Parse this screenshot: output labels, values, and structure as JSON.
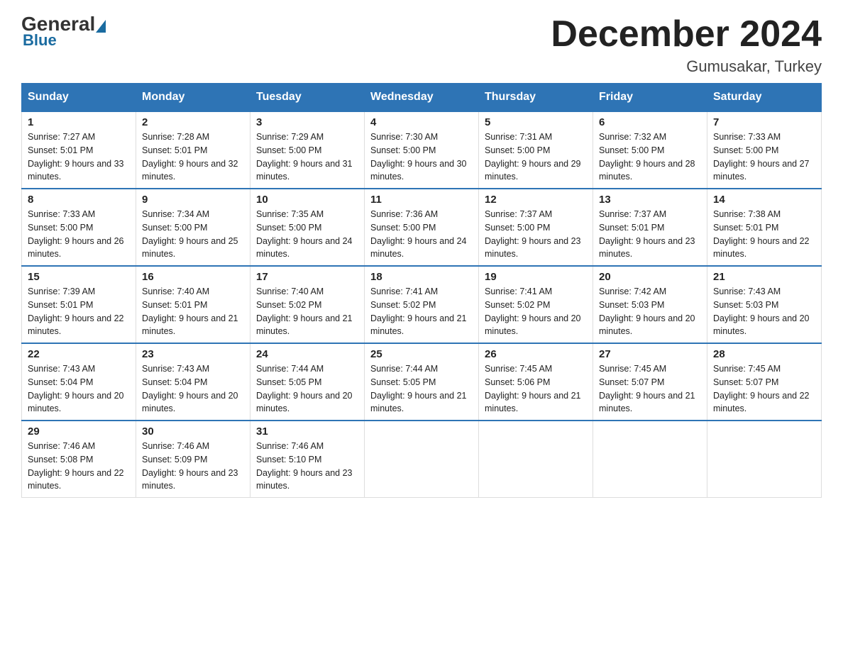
{
  "logo": {
    "general": "General",
    "blue": "Blue"
  },
  "header": {
    "month": "December 2024",
    "location": "Gumusakar, Turkey"
  },
  "days_of_week": [
    "Sunday",
    "Monday",
    "Tuesday",
    "Wednesday",
    "Thursday",
    "Friday",
    "Saturday"
  ],
  "weeks": [
    [
      {
        "day": "1",
        "sunrise": "7:27 AM",
        "sunset": "5:01 PM",
        "daylight": "9 hours and 33 minutes."
      },
      {
        "day": "2",
        "sunrise": "7:28 AM",
        "sunset": "5:01 PM",
        "daylight": "9 hours and 32 minutes."
      },
      {
        "day": "3",
        "sunrise": "7:29 AM",
        "sunset": "5:00 PM",
        "daylight": "9 hours and 31 minutes."
      },
      {
        "day": "4",
        "sunrise": "7:30 AM",
        "sunset": "5:00 PM",
        "daylight": "9 hours and 30 minutes."
      },
      {
        "day": "5",
        "sunrise": "7:31 AM",
        "sunset": "5:00 PM",
        "daylight": "9 hours and 29 minutes."
      },
      {
        "day": "6",
        "sunrise": "7:32 AM",
        "sunset": "5:00 PM",
        "daylight": "9 hours and 28 minutes."
      },
      {
        "day": "7",
        "sunrise": "7:33 AM",
        "sunset": "5:00 PM",
        "daylight": "9 hours and 27 minutes."
      }
    ],
    [
      {
        "day": "8",
        "sunrise": "7:33 AM",
        "sunset": "5:00 PM",
        "daylight": "9 hours and 26 minutes."
      },
      {
        "day": "9",
        "sunrise": "7:34 AM",
        "sunset": "5:00 PM",
        "daylight": "9 hours and 25 minutes."
      },
      {
        "day": "10",
        "sunrise": "7:35 AM",
        "sunset": "5:00 PM",
        "daylight": "9 hours and 24 minutes."
      },
      {
        "day": "11",
        "sunrise": "7:36 AM",
        "sunset": "5:00 PM",
        "daylight": "9 hours and 24 minutes."
      },
      {
        "day": "12",
        "sunrise": "7:37 AM",
        "sunset": "5:00 PM",
        "daylight": "9 hours and 23 minutes."
      },
      {
        "day": "13",
        "sunrise": "7:37 AM",
        "sunset": "5:01 PM",
        "daylight": "9 hours and 23 minutes."
      },
      {
        "day": "14",
        "sunrise": "7:38 AM",
        "sunset": "5:01 PM",
        "daylight": "9 hours and 22 minutes."
      }
    ],
    [
      {
        "day": "15",
        "sunrise": "7:39 AM",
        "sunset": "5:01 PM",
        "daylight": "9 hours and 22 minutes."
      },
      {
        "day": "16",
        "sunrise": "7:40 AM",
        "sunset": "5:01 PM",
        "daylight": "9 hours and 21 minutes."
      },
      {
        "day": "17",
        "sunrise": "7:40 AM",
        "sunset": "5:02 PM",
        "daylight": "9 hours and 21 minutes."
      },
      {
        "day": "18",
        "sunrise": "7:41 AM",
        "sunset": "5:02 PM",
        "daylight": "9 hours and 21 minutes."
      },
      {
        "day": "19",
        "sunrise": "7:41 AM",
        "sunset": "5:02 PM",
        "daylight": "9 hours and 20 minutes."
      },
      {
        "day": "20",
        "sunrise": "7:42 AM",
        "sunset": "5:03 PM",
        "daylight": "9 hours and 20 minutes."
      },
      {
        "day": "21",
        "sunrise": "7:43 AM",
        "sunset": "5:03 PM",
        "daylight": "9 hours and 20 minutes."
      }
    ],
    [
      {
        "day": "22",
        "sunrise": "7:43 AM",
        "sunset": "5:04 PM",
        "daylight": "9 hours and 20 minutes."
      },
      {
        "day": "23",
        "sunrise": "7:43 AM",
        "sunset": "5:04 PM",
        "daylight": "9 hours and 20 minutes."
      },
      {
        "day": "24",
        "sunrise": "7:44 AM",
        "sunset": "5:05 PM",
        "daylight": "9 hours and 20 minutes."
      },
      {
        "day": "25",
        "sunrise": "7:44 AM",
        "sunset": "5:05 PM",
        "daylight": "9 hours and 21 minutes."
      },
      {
        "day": "26",
        "sunrise": "7:45 AM",
        "sunset": "5:06 PM",
        "daylight": "9 hours and 21 minutes."
      },
      {
        "day": "27",
        "sunrise": "7:45 AM",
        "sunset": "5:07 PM",
        "daylight": "9 hours and 21 minutes."
      },
      {
        "day": "28",
        "sunrise": "7:45 AM",
        "sunset": "5:07 PM",
        "daylight": "9 hours and 22 minutes."
      }
    ],
    [
      {
        "day": "29",
        "sunrise": "7:46 AM",
        "sunset": "5:08 PM",
        "daylight": "9 hours and 22 minutes."
      },
      {
        "day": "30",
        "sunrise": "7:46 AM",
        "sunset": "5:09 PM",
        "daylight": "9 hours and 23 minutes."
      },
      {
        "day": "31",
        "sunrise": "7:46 AM",
        "sunset": "5:10 PM",
        "daylight": "9 hours and 23 minutes."
      },
      null,
      null,
      null,
      null
    ]
  ],
  "labels": {
    "sunrise": "Sunrise:",
    "sunset": "Sunset:",
    "daylight": "Daylight:"
  }
}
